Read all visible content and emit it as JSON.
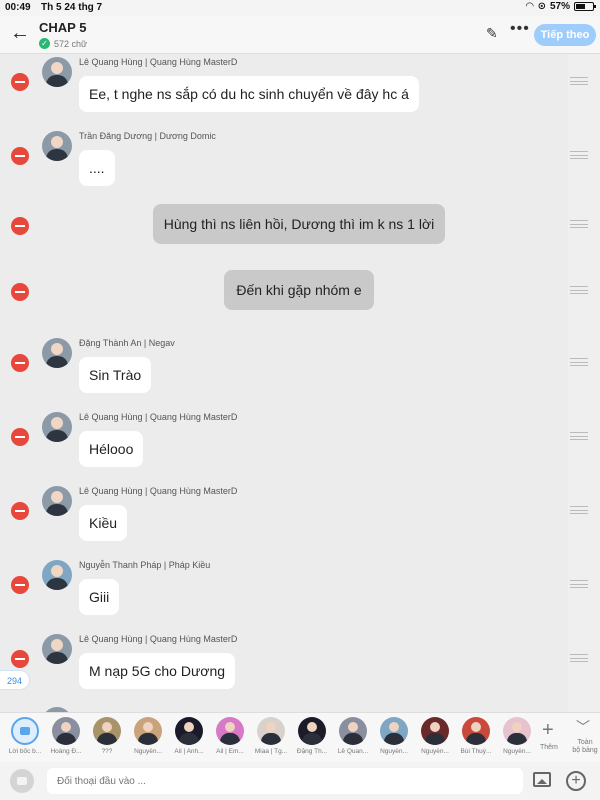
{
  "status": {
    "time": "00:49",
    "date": "Th 5 24 thg 7",
    "battery": "57%",
    "battery_level": 0.57
  },
  "header": {
    "title": "CHAP 5",
    "word_count": "572 chữ",
    "next_label": "Tiếp theo"
  },
  "messages": [
    {
      "type": "char",
      "name": "Lê Quang Hùng | Quang Hùng MasterD",
      "text": "Ee, t nghe ns sắp có du hc sinh chuyển về đây hc á"
    },
    {
      "type": "char",
      "name": "Trần Đăng Dương | Dương Domic",
      "text": "...."
    },
    {
      "type": "narr",
      "text": "Hùng thì ns liên hồi, Dương thì im k ns 1 lời"
    },
    {
      "type": "narr",
      "text": "Đến khi gặp nhóm e"
    },
    {
      "type": "char",
      "name": "Đặng Thành An | Negav",
      "text": "Sin Trào"
    },
    {
      "type": "char",
      "name": "Lê Quang Hùng | Quang Hùng MasterD",
      "text": "Hélooo"
    },
    {
      "type": "char",
      "name": "Lê Quang Hùng | Quang Hùng MasterD",
      "text": "Kiều"
    },
    {
      "type": "char",
      "name": "Nguyễn Thanh Pháp | Pháp Kiều",
      "text": "Giii"
    },
    {
      "type": "char",
      "name": "Lê Quang Hùng | Quang Hùng MasterD",
      "text": "M nạp 5G cho Dương"
    }
  ],
  "count_badge": "294",
  "characters": [
    "Lời bốc b...",
    "Hoàng Đ...",
    "???",
    "Nguyễn...",
    "Ail | Anh...",
    "Ail | Em...",
    "Miaa | Tg...",
    "Đặng Th...",
    "Lê Quan...",
    "Nguyễn...",
    "Nguyễn...",
    "Bùi Thuỳ...",
    "Nguyễn..."
  ],
  "add_label": "Thêm",
  "all_label_1": "Toàn",
  "all_label_2": "bộ bảng",
  "input": {
    "placeholder": "Đối thoại đầu vào ..."
  }
}
